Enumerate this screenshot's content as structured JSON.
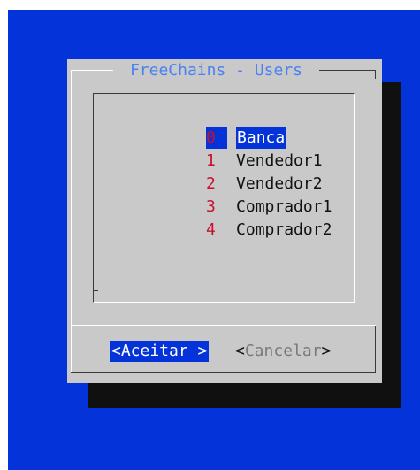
{
  "dialog": {
    "title": "FreeChains - Users"
  },
  "list": {
    "items": [
      {
        "index": "0",
        "label": "Banca",
        "selected": true
      },
      {
        "index": "1",
        "label": "Vendedor1",
        "selected": false
      },
      {
        "index": "2",
        "label": "Vendedor2",
        "selected": false
      },
      {
        "index": "3",
        "label": "Comprador1",
        "selected": false
      },
      {
        "index": "4",
        "label": "Comprador2",
        "selected": false
      }
    ]
  },
  "buttons": {
    "ok_label": "<Aceitar >",
    "cancel_open": "<",
    "cancel_text": "Cancelar",
    "cancel_close": ">"
  },
  "colors": {
    "screen_bg": "#0433d9",
    "dialog_bg": "#c9c9c9",
    "shadow": "#101010",
    "title": "#4a82f2",
    "index": "#c8102e",
    "selection_bg": "#0433d9"
  }
}
